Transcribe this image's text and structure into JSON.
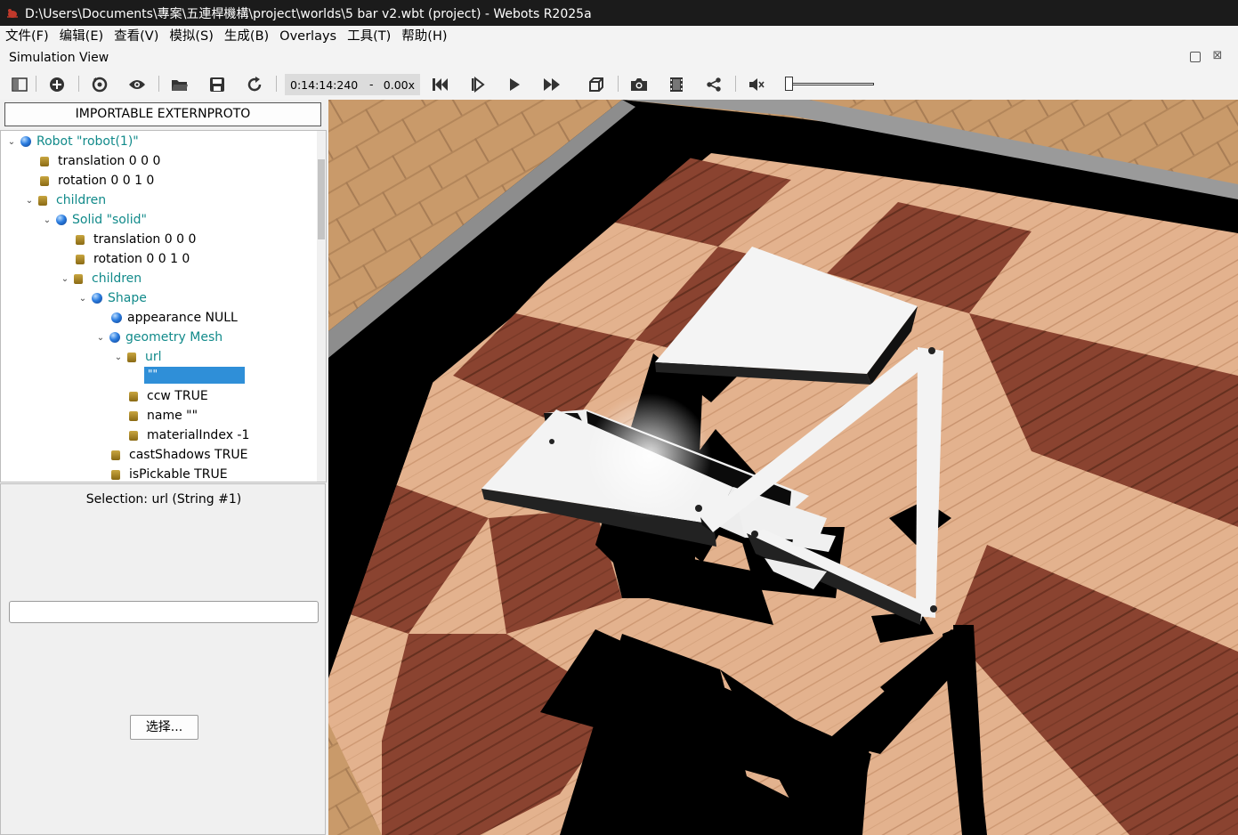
{
  "window": {
    "title": "D:\\Users\\Documents\\專案\\五連桿機構\\project\\worlds\\5 bar v2.wbt (project) - Webots R2025a"
  },
  "menu": [
    "文件(F)",
    "编辑(E)",
    "查看(V)",
    "模拟(S)",
    "生成(B)",
    "Overlays",
    "工具(T)",
    "帮助(H)"
  ],
  "panel": {
    "title": "Simulation View"
  },
  "toolbar": {
    "time": "0:14:14:240",
    "dash": "-",
    "speed": "0.00x",
    "volume": 0.0
  },
  "scene_tree": {
    "button_label": "IMPORTABLE EXTERNPROTO",
    "rows": [
      "Robot \"robot(1)\"",
      "translation 0 0 0",
      "rotation 0 0 1 0",
      "children",
      "Solid \"solid\"",
      "translation 0 0 0",
      "rotation 0 0 1 0",
      "children",
      "Shape",
      "appearance NULL",
      "geometry Mesh",
      "url",
      "ccw TRUE",
      "name \"\"",
      "materialIndex -1",
      "castShadows TRUE",
      "isPickable TRUE"
    ],
    "edit_value": "\"\""
  },
  "field_editor": {
    "selection": "Selection: url (String #1)",
    "input_value": "",
    "choose_label": "选择..."
  },
  "icons": [
    "scene-tree-toggle-icon",
    "add-node-icon",
    "reset-view-icon",
    "eye-icon",
    "open-folder-icon",
    "save-icon",
    "reload-icon",
    "step-back-icon",
    "step-icon",
    "play-icon",
    "fast-forward-icon",
    "cube-view-icon",
    "camera-icon",
    "film-icon",
    "share-icon",
    "mute-icon"
  ]
}
